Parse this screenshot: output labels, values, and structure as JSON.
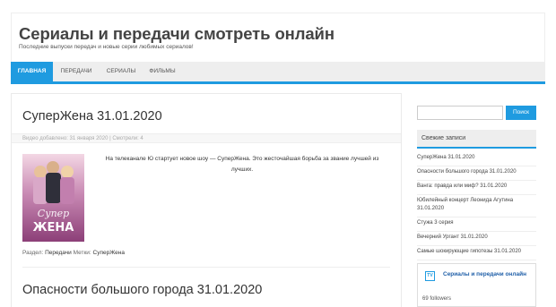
{
  "header": {
    "title": "Сериалы и передачи смотреть онлайн",
    "description": "Последние выпуски передач и новые серии любимых сериалов!"
  },
  "nav": {
    "items": [
      {
        "label": "ГЛАВНАЯ",
        "active": true
      },
      {
        "label": "ПЕРЕДАЧИ",
        "active": false
      },
      {
        "label": "СЕРИАЛЫ",
        "active": false
      },
      {
        "label": "ФИЛЬМЫ",
        "active": false
      }
    ]
  },
  "posts": [
    {
      "title": "СуперЖена 31.01.2020",
      "meta": "Видео добавлено: 31 января 2020 | Смотрели: 4",
      "excerpt": "На телеканале Ю стартует новое шоу — СуперЖена. Это жесточайшая борьба за звание лучшей из лучших.",
      "section_label": "Раздел:",
      "section_value": "Передачи",
      "tags_label": "Метки:",
      "tags_value": "СуперЖена",
      "thumb_text": "ЖЕНА"
    },
    {
      "title": "Опасности большого города 31.01.2020"
    }
  ],
  "sidebar": {
    "search": {
      "placeholder": "",
      "button_label": "Поиск"
    },
    "recent_title": "Свежие записи",
    "recent": [
      "СуперЖена 31.01.2020",
      "Опасности большого города 31.01.2020",
      "Ванга: правда или миф? 31.01.2020",
      "Юбилейный концерт Леонида Агутина 31.01.2020",
      "Стужа 3 серия",
      "Вечерний Ургант 31.01.2020",
      "Самые шокирующие гипотезы 31.01.2020"
    ],
    "fb": {
      "logo": "TV",
      "title": "Сериалы и передачи онлайн",
      "followers": "69 followers"
    }
  },
  "colors": {
    "accent": "#1f9be0",
    "nav_bg": "#eeeeee"
  }
}
